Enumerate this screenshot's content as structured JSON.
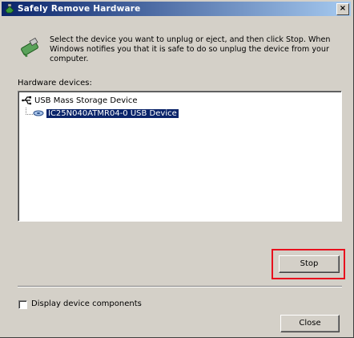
{
  "window": {
    "title": "Safely Remove Hardware",
    "close_glyph": "×"
  },
  "instructions": "Select the device you want to unplug or eject, and then click Stop. When Windows notifies you that it is safe to do so unplug the device from your computer.",
  "hardware_devices_label": "Hardware devices:",
  "tree": {
    "root": {
      "label": "USB Mass Storage Device",
      "icon": "usb-icon"
    },
    "child": {
      "label": "IC25N040ATMR04-0 USB Device",
      "icon": "disk-drive-icon",
      "selected": true
    }
  },
  "buttons": {
    "stop": "Stop",
    "close": "Close"
  },
  "checkbox": {
    "label": "Display device components",
    "checked": false
  },
  "colors": {
    "title_bar_start": "#0a246a",
    "title_bar_end": "#a6caf0",
    "selection": "#0a246a",
    "highlight_border": "#e8101e",
    "dialog_face": "#d4d0c8"
  }
}
